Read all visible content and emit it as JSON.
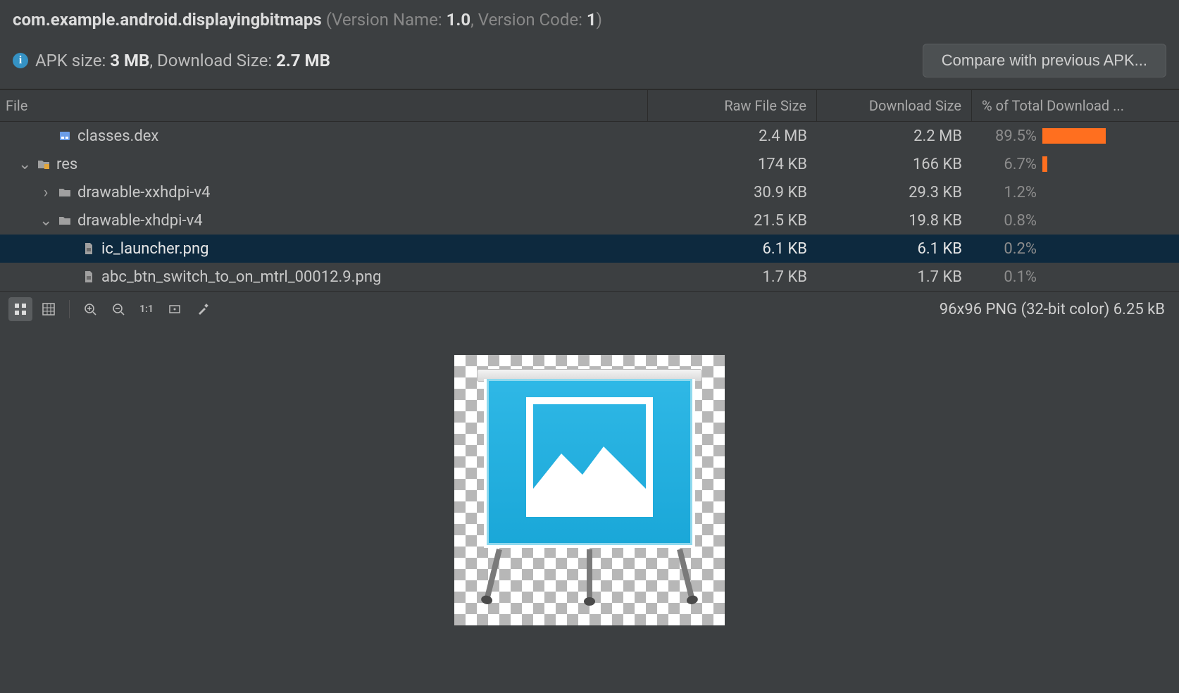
{
  "header": {
    "package": "com.example.android.displayingbitmaps",
    "version_name_label": "Version Name:",
    "version_name": "1.0",
    "version_code_label": "Version Code:",
    "version_code": "1"
  },
  "size": {
    "apk_label": "APK size:",
    "apk_value": "3 MB",
    "dl_label": "Download Size:",
    "dl_value": "2.7 MB"
  },
  "compare_button": "Compare with previous APK...",
  "columns": {
    "file": "File",
    "raw": "Raw File Size",
    "download": "Download Size",
    "percent": "% of Total Download ..."
  },
  "rows": [
    {
      "indent": 1,
      "chevron": "",
      "icon": "dex",
      "name": "classes.dex",
      "raw": "2.4 MB",
      "dl": "2.2 MB",
      "pct": "89.5%",
      "bar": 90,
      "selected": false
    },
    {
      "indent": 0,
      "chevron": "⌄",
      "icon": "resfolder",
      "name": "res",
      "raw": "174 KB",
      "dl": "166 KB",
      "pct": "6.7%",
      "bar": 7,
      "selected": false
    },
    {
      "indent": 1,
      "chevron": "›",
      "icon": "folder",
      "name": "drawable-xxhdpi-v4",
      "raw": "30.9 KB",
      "dl": "29.3 KB",
      "pct": "1.2%",
      "bar": 0,
      "selected": false
    },
    {
      "indent": 1,
      "chevron": "⌄",
      "icon": "folder",
      "name": "drawable-xhdpi-v4",
      "raw": "21.5 KB",
      "dl": "19.8 KB",
      "pct": "0.8%",
      "bar": 0,
      "selected": false
    },
    {
      "indent": 2,
      "chevron": "",
      "icon": "file",
      "name": "ic_launcher.png",
      "raw": "6.1 KB",
      "dl": "6.1 KB",
      "pct": "0.2%",
      "bar": 0,
      "selected": true
    },
    {
      "indent": 2,
      "chevron": "",
      "icon": "file",
      "name": "abc_btn_switch_to_on_mtrl_00012.9.png",
      "raw": "1.7 KB",
      "dl": "1.7 KB",
      "pct": "0.1%",
      "bar": 0,
      "selected": false
    }
  ],
  "preview": {
    "info": "96x96 PNG (32-bit color) 6.25 kB"
  }
}
